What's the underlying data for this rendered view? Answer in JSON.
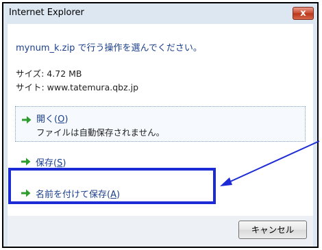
{
  "window": {
    "title": "Internet Explorer",
    "close_label": "x"
  },
  "prompt": "mynum_k.zip で行う操作を選んでください。",
  "info": {
    "size": "サイズ: 4.72 MB",
    "site": "サイト: www.tatemura.qbz.jp"
  },
  "options": [
    {
      "label": "開く(O)",
      "sub": "ファイルは自動保存されません。"
    },
    {
      "label": "保存(S)"
    },
    {
      "label": "名前を付けて保存(A)"
    }
  ],
  "cancel_label": "キャンセル",
  "colors": {
    "highlight": "#1d2bd6",
    "link": "#1b3f8c",
    "arrow": "#2e9d2e"
  }
}
